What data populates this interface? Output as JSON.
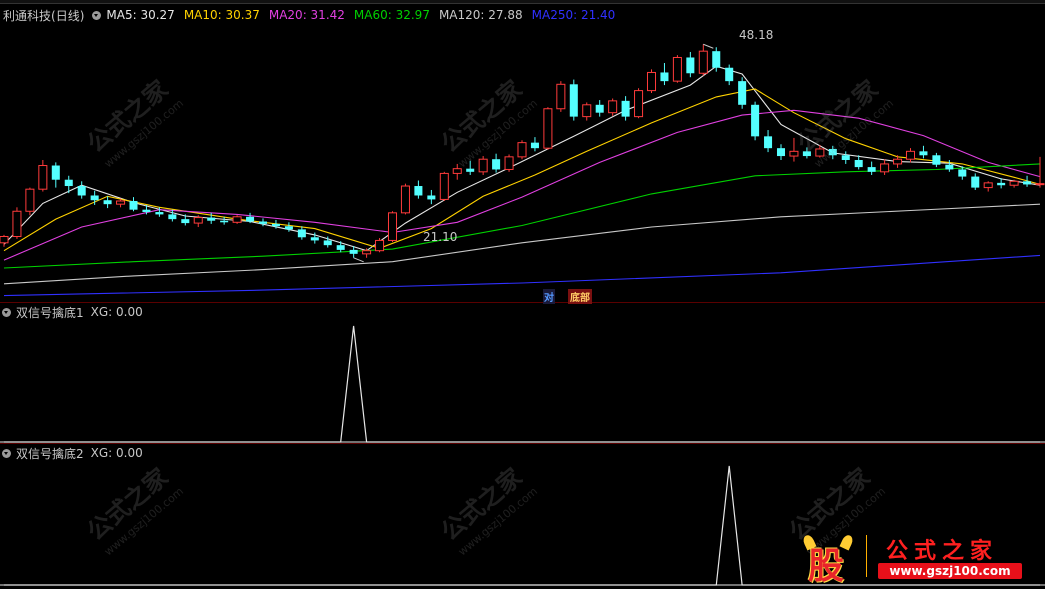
{
  "header": {
    "stock_name": "利通科技",
    "period": "(日线)",
    "ma": [
      {
        "label": "MA5: 30.27",
        "color": "#e6e6e6"
      },
      {
        "label": "MA10: 30.37",
        "color": "#ffd200"
      },
      {
        "label": "MA20: 31.42",
        "color": "#e040e0"
      },
      {
        "label": "MA60: 32.97",
        "color": "#00d000"
      },
      {
        "label": "MA120: 27.88",
        "color": "#c8c8c8"
      },
      {
        "label": "MA250: 21.40",
        "color": "#3030ff"
      }
    ]
  },
  "annotations": {
    "high": "48.18",
    "low": "21.10"
  },
  "tags": {
    "tag1": "对",
    "tag2": "底部"
  },
  "panel2": {
    "name": "双信号擒底1",
    "value": "XG: 0.00"
  },
  "panel3": {
    "name": "双信号擒底2",
    "value": "XG: 0.00"
  },
  "watermark": {
    "cn": "公式之家",
    "url": "www.gszj100.com"
  },
  "logo": {
    "char": "股",
    "cn": "公式之家",
    "url": "www.gszj100.com"
  },
  "colors": {
    "up": "#ff3b3b",
    "down": "#54ffff",
    "bg": "#000000"
  },
  "chart_data": [
    {
      "type": "candlestick",
      "ylim": [
        16,
        51
      ],
      "candles": [
        [
          23.0,
          24.0,
          22.5,
          23.8
        ],
        [
          23.8,
          27.5,
          23.5,
          27.0
        ],
        [
          27.0,
          30.0,
          26.5,
          29.8
        ],
        [
          29.8,
          33.5,
          29.5,
          32.8
        ],
        [
          32.8,
          33.2,
          30.0,
          31.0
        ],
        [
          31.0,
          31.5,
          29.3,
          30.2
        ],
        [
          30.2,
          30.8,
          28.6,
          29.0
        ],
        [
          29.0,
          29.6,
          27.8,
          28.4
        ],
        [
          28.4,
          28.9,
          27.4,
          27.9
        ],
        [
          27.9,
          28.6,
          27.5,
          28.3
        ],
        [
          28.3,
          28.8,
          27.0,
          27.2
        ],
        [
          27.2,
          27.8,
          26.6,
          26.9
        ],
        [
          26.9,
          27.5,
          26.3,
          26.6
        ],
        [
          26.6,
          27.2,
          25.7,
          26.0
        ],
        [
          26.0,
          26.6,
          25.2,
          25.5
        ],
        [
          25.5,
          26.5,
          25.0,
          26.2
        ],
        [
          26.2,
          26.8,
          25.4,
          25.8
        ],
        [
          25.8,
          26.3,
          25.3,
          25.6
        ],
        [
          25.6,
          26.5,
          25.4,
          26.3
        ],
        [
          26.3,
          26.8,
          25.5,
          25.7
        ],
        [
          25.7,
          26.1,
          25.1,
          25.4
        ],
        [
          25.4,
          25.9,
          24.8,
          25.1
        ],
        [
          25.1,
          25.6,
          24.4,
          24.7
        ],
        [
          24.7,
          25.1,
          23.4,
          23.7
        ],
        [
          23.7,
          24.3,
          22.9,
          23.3
        ],
        [
          23.3,
          23.8,
          22.4,
          22.7
        ],
        [
          22.7,
          23.2,
          21.8,
          22.1
        ],
        [
          22.1,
          22.6,
          21.1,
          21.6
        ],
        [
          21.6,
          22.3,
          21.1,
          22.0
        ],
        [
          22.0,
          23.6,
          21.8,
          23.3
        ],
        [
          23.3,
          27.0,
          23.1,
          26.8
        ],
        [
          26.8,
          30.5,
          26.6,
          30.2
        ],
        [
          30.2,
          30.9,
          28.6,
          29.0
        ],
        [
          29.0,
          29.7,
          27.9,
          28.5
        ],
        [
          28.5,
          32.0,
          28.3,
          31.8
        ],
        [
          31.8,
          33.0,
          31.0,
          32.4
        ],
        [
          32.4,
          33.4,
          31.6,
          32.0
        ],
        [
          32.0,
          34.0,
          31.6,
          33.6
        ],
        [
          33.6,
          34.3,
          31.9,
          32.3
        ],
        [
          32.3,
          34.2,
          32.0,
          33.9
        ],
        [
          33.9,
          36.0,
          33.6,
          35.7
        ],
        [
          35.7,
          36.4,
          34.6,
          35.0
        ],
        [
          35.0,
          40.2,
          34.8,
          40.0
        ],
        [
          40.0,
          43.5,
          39.6,
          43.1
        ],
        [
          43.1,
          43.7,
          38.5,
          39.0
        ],
        [
          39.0,
          40.8,
          38.5,
          40.5
        ],
        [
          40.5,
          41.1,
          39.0,
          39.5
        ],
        [
          39.5,
          41.3,
          39.1,
          41.0
        ],
        [
          41.0,
          41.6,
          38.5,
          39.0
        ],
        [
          39.0,
          42.6,
          38.8,
          42.3
        ],
        [
          42.3,
          45.0,
          42.0,
          44.6
        ],
        [
          44.6,
          45.8,
          43.0,
          43.5
        ],
        [
          43.5,
          46.8,
          43.3,
          46.5
        ],
        [
          46.5,
          47.2,
          44.0,
          44.5
        ],
        [
          44.5,
          48.18,
          44.2,
          47.3
        ],
        [
          47.3,
          47.8,
          44.7,
          45.2
        ],
        [
          45.2,
          45.6,
          43.0,
          43.5
        ],
        [
          43.5,
          44.0,
          40.0,
          40.5
        ],
        [
          40.5,
          40.9,
          36.0,
          36.5
        ],
        [
          36.5,
          37.3,
          34.5,
          35.0
        ],
        [
          35.0,
          35.5,
          33.5,
          34.0
        ],
        [
          34.0,
          36.3,
          33.3,
          34.6
        ],
        [
          34.6,
          35.1,
          33.7,
          34.0
        ],
        [
          34.0,
          35.4,
          33.8,
          34.9
        ],
        [
          34.9,
          35.3,
          33.6,
          34.1
        ],
        [
          34.1,
          34.6,
          33.0,
          33.5
        ],
        [
          33.5,
          34.1,
          32.3,
          32.6
        ],
        [
          32.6,
          33.3,
          31.6,
          32.0
        ],
        [
          32.0,
          33.6,
          31.6,
          33.0
        ],
        [
          33.0,
          34.1,
          32.5,
          33.6
        ],
        [
          33.6,
          35.0,
          33.2,
          34.6
        ],
        [
          34.6,
          35.3,
          33.7,
          34.1
        ],
        [
          34.1,
          34.4,
          32.6,
          32.9
        ],
        [
          32.9,
          33.5,
          32.0,
          32.3
        ],
        [
          32.3,
          32.7,
          31.0,
          31.4
        ],
        [
          31.4,
          31.8,
          29.7,
          30.0
        ],
        [
          30.0,
          30.8,
          29.5,
          30.6
        ],
        [
          30.6,
          31.2,
          29.9,
          30.3
        ],
        [
          30.3,
          31.0,
          30.0,
          30.8
        ],
        [
          30.8,
          31.5,
          30.1,
          30.4
        ],
        [
          30.4,
          33.9,
          30.0,
          30.5
        ]
      ],
      "ma_series": [
        {
          "name": "MA5",
          "color": "#e6e6e6",
          "values": [
            [
              0,
              22.8
            ],
            [
              3,
              28.0
            ],
            [
              6,
              30.3
            ],
            [
              10,
              28.1
            ],
            [
              14,
              26.4
            ],
            [
              19,
              25.7
            ],
            [
              24,
              24.0
            ],
            [
              28,
              22.0
            ],
            [
              31,
              25.5
            ],
            [
              35,
              29.4
            ],
            [
              39,
              32.5
            ],
            [
              44,
              36.5
            ],
            [
              48,
              39.8
            ],
            [
              53,
              43.0
            ],
            [
              55,
              45.4
            ],
            [
              57,
              44.4
            ],
            [
              60,
              38.0
            ],
            [
              64,
              34.4
            ],
            [
              69,
              33.3
            ],
            [
              73,
              33.1
            ],
            [
              77,
              31.1
            ],
            [
              80,
              30.3
            ]
          ]
        },
        {
          "name": "MA10",
          "color": "#ffd200",
          "values": [
            [
              0,
              22.0
            ],
            [
              4,
              26.0
            ],
            [
              8,
              28.9
            ],
            [
              12,
              27.5
            ],
            [
              18,
              26.0
            ],
            [
              24,
              24.8
            ],
            [
              29,
              22.3
            ],
            [
              33,
              24.8
            ],
            [
              37,
              28.9
            ],
            [
              41,
              31.6
            ],
            [
              45,
              34.6
            ],
            [
              50,
              38.2
            ],
            [
              55,
              41.5
            ],
            [
              58,
              42.5
            ],
            [
              61,
              39.5
            ],
            [
              65,
              36.2
            ],
            [
              69,
              33.9
            ],
            [
              74,
              33.0
            ],
            [
              78,
              31.3
            ],
            [
              80,
              30.4
            ]
          ]
        },
        {
          "name": "MA20",
          "color": "#e040e0",
          "values": [
            [
              0,
              20.8
            ],
            [
              6,
              25.0
            ],
            [
              12,
              27.2
            ],
            [
              18,
              26.6
            ],
            [
              24,
              25.6
            ],
            [
              30,
              24.3
            ],
            [
              35,
              25.6
            ],
            [
              40,
              28.8
            ],
            [
              46,
              33.2
            ],
            [
              52,
              37.0
            ],
            [
              57,
              39.2
            ],
            [
              61,
              39.8
            ],
            [
              66,
              38.8
            ],
            [
              71,
              36.6
            ],
            [
              76,
              33.2
            ],
            [
              80,
              31.4
            ]
          ]
        },
        {
          "name": "MA60",
          "color": "#00d000",
          "values": [
            [
              0,
              19.8
            ],
            [
              10,
              20.6
            ],
            [
              20,
              21.3
            ],
            [
              30,
              22.2
            ],
            [
              40,
              25.2
            ],
            [
              50,
              29.2
            ],
            [
              58,
              31.5
            ],
            [
              65,
              32.0
            ],
            [
              72,
              32.3
            ],
            [
              80,
              33.0
            ]
          ]
        },
        {
          "name": "MA120",
          "color": "#c8c8c8",
          "values": [
            [
              0,
              17.8
            ],
            [
              10,
              18.8
            ],
            [
              20,
              19.6
            ],
            [
              30,
              20.6
            ],
            [
              40,
              23.0
            ],
            [
              50,
              25.0
            ],
            [
              60,
              26.3
            ],
            [
              70,
              27.1
            ],
            [
              80,
              27.9
            ]
          ]
        },
        {
          "name": "MA250",
          "color": "#3030ff",
          "values": [
            [
              0,
              16.3
            ],
            [
              20,
              17.0
            ],
            [
              40,
              17.9
            ],
            [
              60,
              19.2
            ],
            [
              80,
              21.4
            ]
          ]
        }
      ]
    },
    {
      "type": "line",
      "title": "双信号擒底1",
      "x": [
        0,
        26,
        27,
        28,
        80
      ],
      "values": [
        0,
        0,
        1,
        0,
        0
      ],
      "ylim": [
        0,
        1
      ]
    },
    {
      "type": "line",
      "title": "双信号擒底2",
      "x": [
        0,
        55,
        56,
        57,
        80
      ],
      "values": [
        0,
        0,
        1,
        0,
        0
      ],
      "ylim": [
        0,
        1
      ]
    }
  ]
}
